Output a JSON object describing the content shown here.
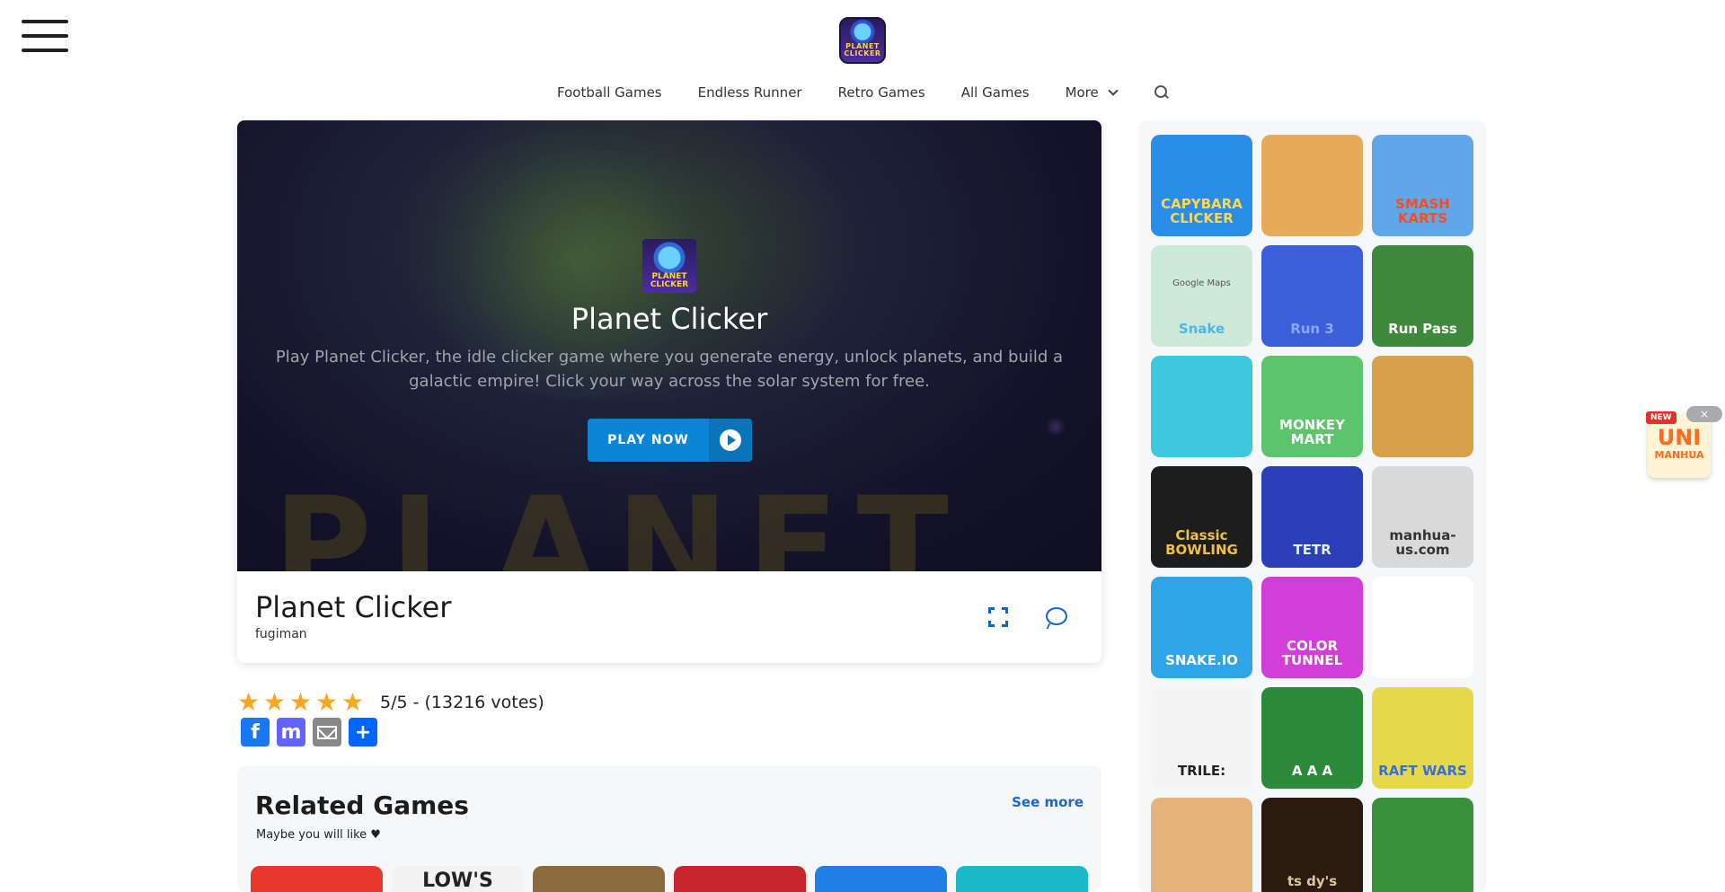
{
  "site": {
    "logo_text": "PLANET CLICKER"
  },
  "nav": {
    "items": [
      "Football Games",
      "Endless Runner",
      "Retro Games",
      "All Games"
    ],
    "more_label": "More"
  },
  "hero": {
    "icon_text": "PLANET CLICKER",
    "title": "Planet Clicker",
    "description": "Play Planet Clicker, the idle clicker game where you generate energy, unlock planets, and build a galactic empire! Click your way across the solar system for free.",
    "play_label": "PLAY NOW",
    "background_text": "PLANET"
  },
  "game": {
    "title": "Planet Clicker",
    "author": "fugiman"
  },
  "rating": {
    "stars": 5,
    "text": "5/5 - (13216 votes)"
  },
  "share": [
    "Facebook",
    "Mastodon",
    "Email",
    "Share"
  ],
  "related": {
    "title": "Related Games",
    "subtitle": "Maybe you will like ♥",
    "see_more": "See more",
    "thumbs": [
      {
        "bg": "#e8372c"
      },
      {
        "bg": "#f2f2f2",
        "label": "LOW'S"
      },
      {
        "bg": "#8b6a3e"
      },
      {
        "bg": "#c9252e"
      },
      {
        "bg": "#1f7fe6"
      },
      {
        "bg": "#1bb9c9"
      }
    ]
  },
  "sidebar_games": [
    {
      "name": "capybara-clicker",
      "label": "CAPYBARA CLICKER",
      "bg": "#2a8de8",
      "fg": "#ffd84a"
    },
    {
      "name": "moto-x3m",
      "label": "",
      "bg": "#e7a95a",
      "fg": "#222"
    },
    {
      "name": "smash-karts",
      "label": "SMASH KARTS",
      "bg": "#5fa7e8",
      "fg": "#ff4a1c"
    },
    {
      "name": "google-snake",
      "label": "Snake",
      "bg": "#cde9d8",
      "fg": "#4db6e6",
      "sub": "Google Maps"
    },
    {
      "name": "run-3",
      "label": "Run 3",
      "bg": "#3b5fd8",
      "fg": "#8aa6ff"
    },
    {
      "name": "retro-bowl",
      "label": "Run   Pass",
      "bg": "#3d8a3d",
      "fg": "#fff"
    },
    {
      "name": "bunny-game",
      "label": "",
      "bg": "#3fc7e0",
      "fg": "#fff"
    },
    {
      "name": "monkey-mart",
      "label": "MONKEY MART",
      "bg": "#5cc46a",
      "fg": "#fff"
    },
    {
      "name": "color-tunnel",
      "label": "",
      "bg": "#d8a04a",
      "fg": "#fff"
    },
    {
      "name": "classic-bowling",
      "label": "Classic BOWLING",
      "bg": "#1d1d1d",
      "fg": "#f0c040"
    },
    {
      "name": "tetris",
      "label": "TETR",
      "bg": "#2b3fb8",
      "fg": "#e6efff"
    },
    {
      "name": "manhua",
      "label": "manhua-us.com",
      "bg": "#d9d9d9",
      "fg": "#333"
    },
    {
      "name": "snake-io",
      "label": "SNAKE.IO",
      "bg": "#2fa5e8",
      "fg": "#fff"
    },
    {
      "name": "color-tunnel-2",
      "label": "COLOR TUNNEL",
      "bg": "#d23fd8",
      "fg": "#fff"
    },
    {
      "name": "blank-game",
      "label": "",
      "bg": "#ffffff",
      "fg": "#333"
    },
    {
      "name": "text-game",
      "label": "TRILE:",
      "bg": "#f4f4f4",
      "fg": "#222"
    },
    {
      "name": "solitaire",
      "label": "A A A",
      "bg": "#2d8a3a",
      "fg": "#fff"
    },
    {
      "name": "craft-wars",
      "label": "RAFT WARS",
      "bg": "#e5d84a",
      "fg": "#3a6fd8"
    },
    {
      "name": "road-racer",
      "label": "",
      "bg": "#e5b47a",
      "fg": "#fff"
    },
    {
      "name": "fnaf",
      "label": "ts   dy's",
      "bg": "#2a1a10",
      "fg": "#d8c8a0"
    },
    {
      "name": "pixel-football",
      "label": "",
      "bg": "#3a8f3a",
      "fg": "#fff"
    }
  ],
  "ad": {
    "new_label": "NEW",
    "brand": "UNI",
    "brand_sub": "MANHUA",
    "close": "×"
  },
  "colors": {
    "accent": "#0b86d6",
    "link": "#1a66cc",
    "star": "#f5a623"
  }
}
